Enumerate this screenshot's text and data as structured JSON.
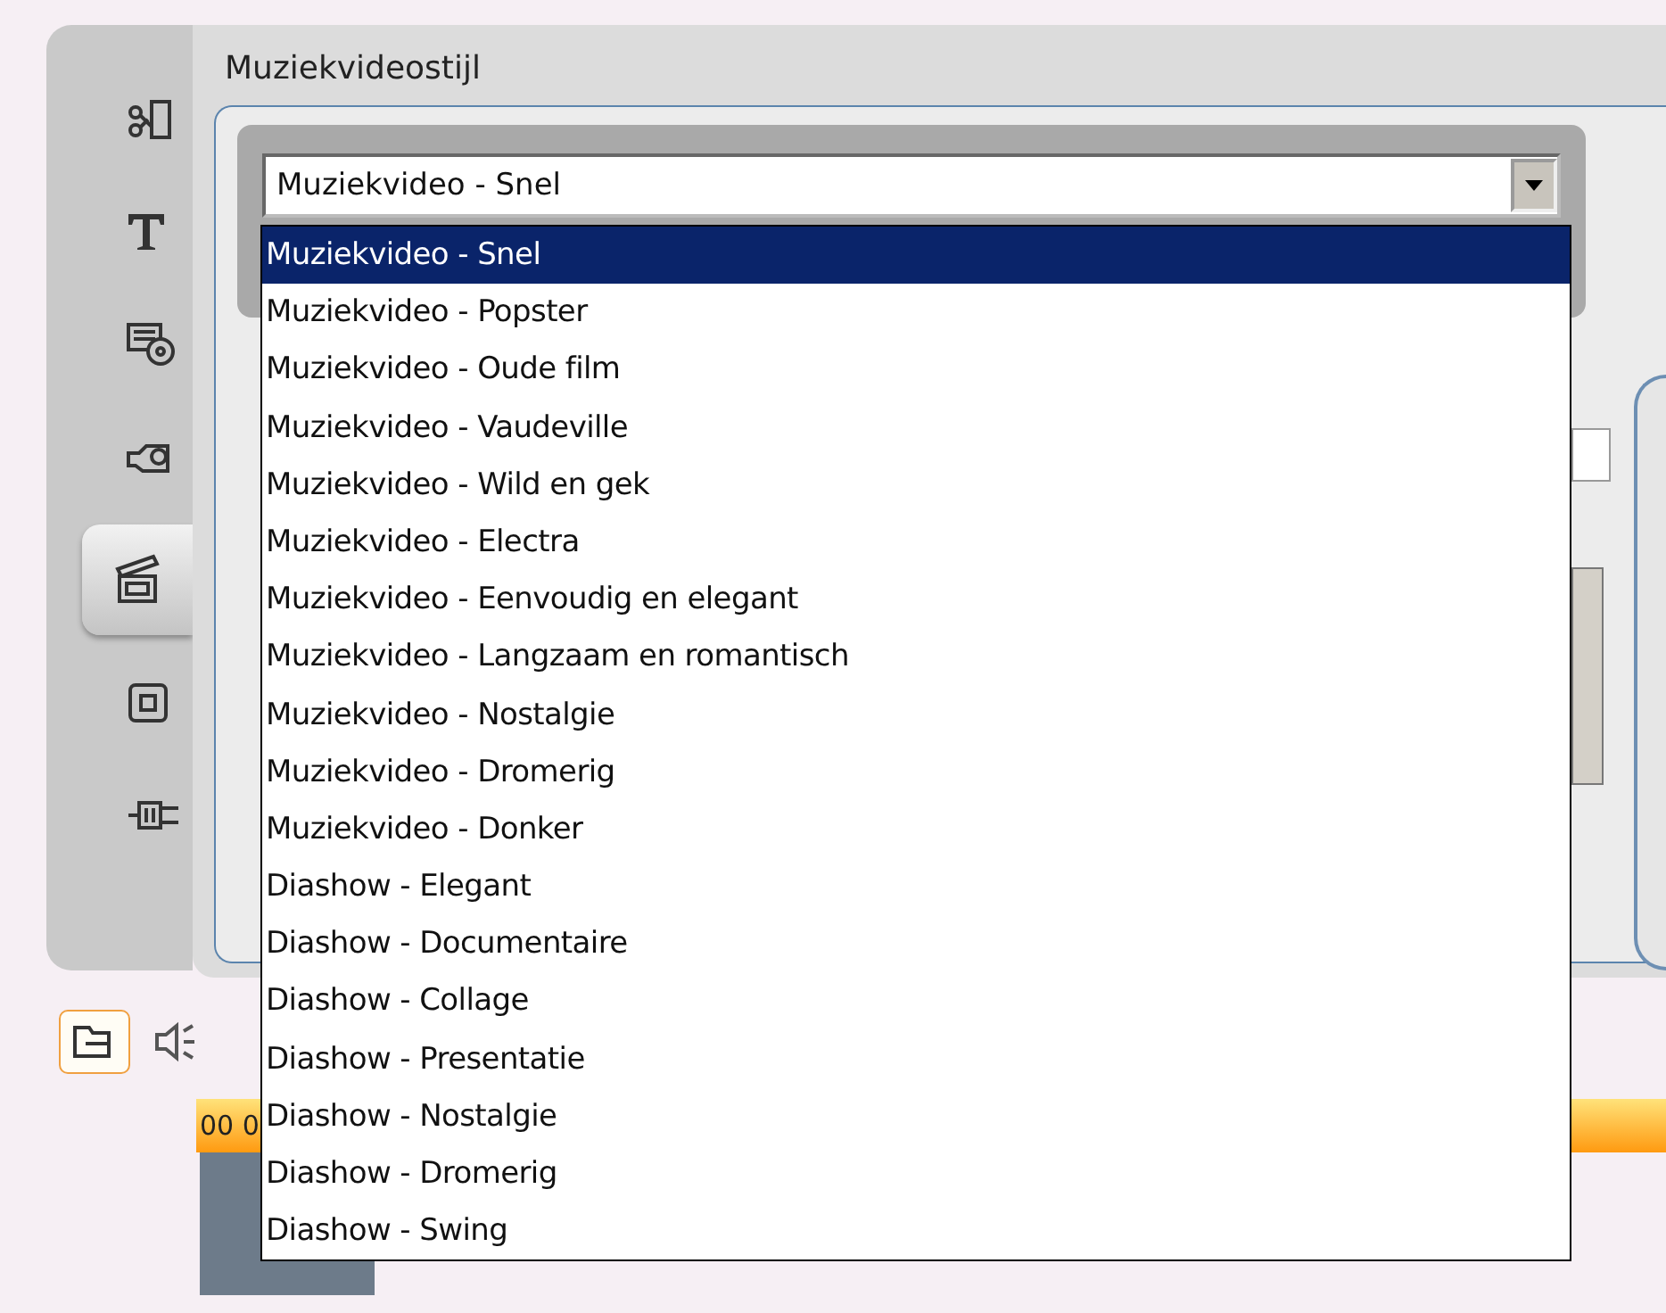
{
  "sidebar": {
    "items": [
      {
        "kind": "scissors",
        "selected": false
      },
      {
        "kind": "text",
        "selected": false
      },
      {
        "kind": "disc",
        "selected": false
      },
      {
        "kind": "camera",
        "selected": false
      },
      {
        "kind": "clapper",
        "selected": true
      },
      {
        "kind": "frame",
        "selected": false
      },
      {
        "kind": "plug",
        "selected": false
      }
    ]
  },
  "panel": {
    "title": "Muziekvideostijl",
    "style_select": {
      "value": "Muziekvideo - Snel",
      "expanded": true,
      "options": [
        {
          "label": "Muziekvideo - Snel",
          "selected": true
        },
        {
          "label": "Muziekvideo - Popster",
          "selected": false
        },
        {
          "label": "Muziekvideo - Oude film",
          "selected": false
        },
        {
          "label": "Muziekvideo - Vaudeville",
          "selected": false
        },
        {
          "label": "Muziekvideo - Wild en gek",
          "selected": false
        },
        {
          "label": "Muziekvideo - Electra",
          "selected": false
        },
        {
          "label": "Muziekvideo - Eenvoudig en elegant",
          "selected": false
        },
        {
          "label": "Muziekvideo - Langzaam en romantisch",
          "selected": false
        },
        {
          "label": "Muziekvideo - Nostalgie",
          "selected": false
        },
        {
          "label": "Muziekvideo - Dromerig",
          "selected": false
        },
        {
          "label": "Muziekvideo - Donker",
          "selected": false
        },
        {
          "label": "Diashow - Elegant",
          "selected": false
        },
        {
          "label": "Diashow - Documentaire",
          "selected": false
        },
        {
          "label": "Diashow - Collage",
          "selected": false
        },
        {
          "label": "Diashow - Presentatie",
          "selected": false
        },
        {
          "label": "Diashow - Nostalgie",
          "selected": false
        },
        {
          "label": "Diashow - Dromerig",
          "selected": false
        },
        {
          "label": "Diashow - Swing",
          "selected": false
        }
      ]
    }
  },
  "timeline": {
    "tabs": [
      {
        "kind": "video",
        "selected": true
      },
      {
        "kind": "audio",
        "selected": false
      }
    ],
    "timecode": "00 0"
  }
}
